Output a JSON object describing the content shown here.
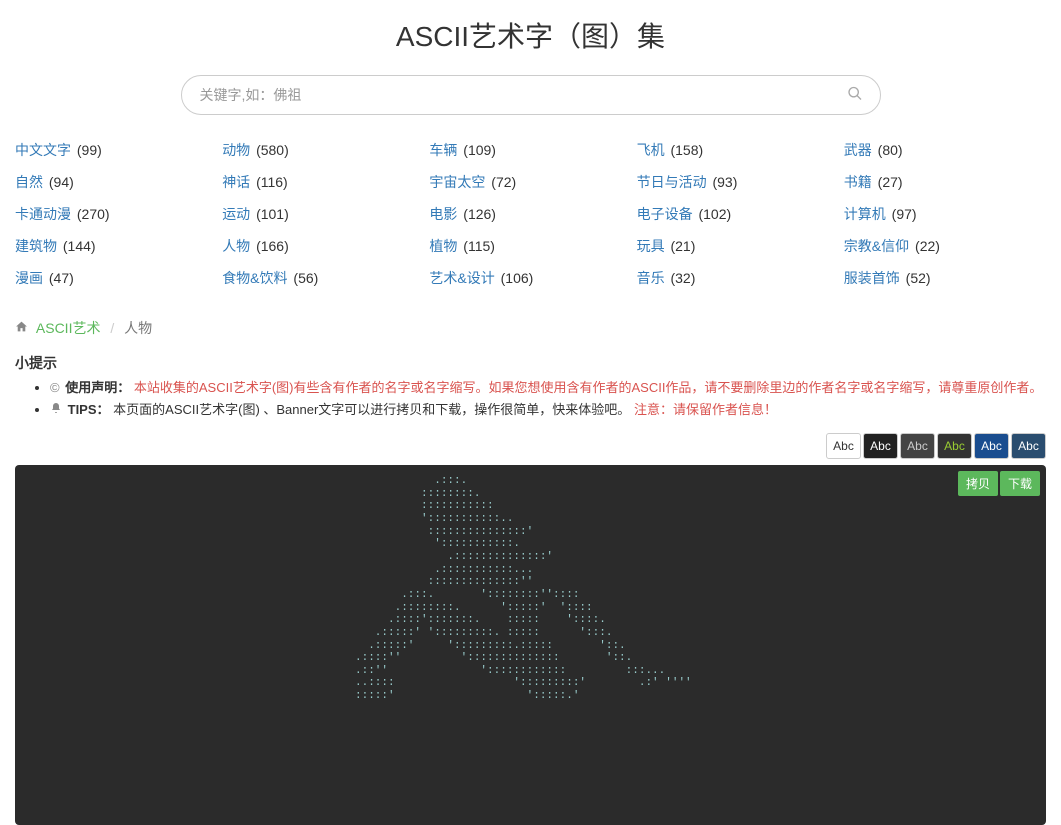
{
  "page": {
    "title": "ASCII艺术字（图）集",
    "search_placeholder": "关键字,如：佛祖"
  },
  "categories": [
    {
      "name": "中文文字",
      "count": 99
    },
    {
      "name": "动物",
      "count": 580
    },
    {
      "name": "车辆",
      "count": 109
    },
    {
      "name": "飞机",
      "count": 158
    },
    {
      "name": "武器",
      "count": 80
    },
    {
      "name": "自然",
      "count": 94
    },
    {
      "name": "神话",
      "count": 116
    },
    {
      "name": "宇宙太空",
      "count": 72
    },
    {
      "name": "节日与活动",
      "count": 93
    },
    {
      "name": "书籍",
      "count": 27
    },
    {
      "name": "卡通动漫",
      "count": 270
    },
    {
      "name": "运动",
      "count": 101
    },
    {
      "name": "电影",
      "count": 126
    },
    {
      "name": "电子设备",
      "count": 102
    },
    {
      "name": "计算机",
      "count": 97
    },
    {
      "name": "建筑物",
      "count": 144
    },
    {
      "name": "人物",
      "count": 166
    },
    {
      "name": "植物",
      "count": 115
    },
    {
      "name": "玩具",
      "count": 21
    },
    {
      "name": "宗教&信仰",
      "count": 22
    },
    {
      "name": "漫画",
      "count": 47
    },
    {
      "name": "食物&饮料",
      "count": 56
    },
    {
      "name": "艺术&设计",
      "count": 106
    },
    {
      "name": "音乐",
      "count": 32
    },
    {
      "name": "服装首饰",
      "count": 52
    }
  ],
  "breadcrumb": {
    "home": "ASCII艺术",
    "current": "人物"
  },
  "tips": {
    "header": "小提示",
    "item1_label": "使用声明：",
    "item1_text": "本站收集的ASCII艺术字(图)有些含有作者的名字或名字缩写。如果您想使用含有作者的ASCII作品，请不要删除里边的作者名字或名字缩写，请尊重原创作者。",
    "item2_label": "TIPS：",
    "item2_text": "本页面的ASCII艺术字(图) 、Banner文字可以进行拷贝和下载，操作很简单，快来体验吧。",
    "item2_warn": "注意：请保留作者信息！"
  },
  "themes": {
    "label": "Abc"
  },
  "art_box": {
    "copy": "拷贝",
    "download": "下载",
    "ascii": "            .:::.\n          ::::::::.\n          :::::::::::\n          ':::::::::::..\n           :::::::::::::::'\n            ':::::::::::.\n              .::::::::::::::'\n            .:::::::::::...\n           ::::::::::::::''\n       .:::.       '::::::::''::::\n      .::::::::.      ':::::'  '::::\n     .::::':::::::.    :::::    '::::.\n   .:::::' ':::::::::. :::::      ':::.\n  .:::::'     ':::::::::.:::::       '::.\n.::::''         '::::::::::::::       '::.\n.::''              '::::::::::::         :::...\n..::::                  ':::::::::'        .:' ''''\n:::::'                    ':::::.'"
  }
}
